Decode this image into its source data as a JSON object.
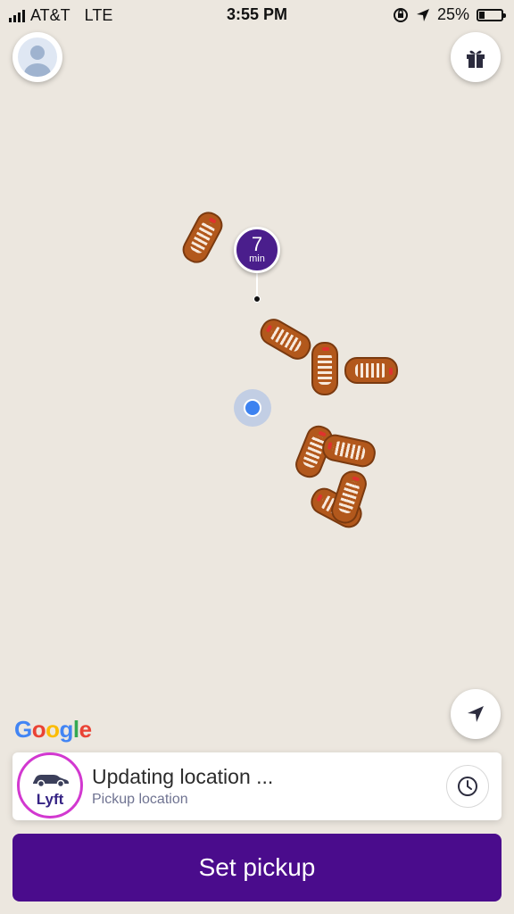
{
  "status_bar": {
    "carrier": "AT&T",
    "network": "LTE",
    "time": "3:55 PM",
    "battery": "25%",
    "battery_level": 0.25
  },
  "map": {
    "eta": {
      "value": "7",
      "unit": "min"
    },
    "google_logo": "Google",
    "icons": {
      "profile": "profile-avatar-icon",
      "gift": "gift-icon",
      "locate": "location-arrow-icon",
      "car": "car-marker-icon"
    }
  },
  "pickup_card": {
    "brand": "Lyft",
    "title": "Updating location ...",
    "subtitle": "Pickup location",
    "schedule_icon": "clock-icon"
  },
  "primary_action": {
    "label": "Set pickup"
  },
  "colors": {
    "brand_purple": "#4a0c8c",
    "eta_purple": "#4a1e8c",
    "lyft_pink": "#d238d0",
    "user_dot": "#3d82f0",
    "map_bg": "#ece7df",
    "car_body": "#b2581c"
  }
}
